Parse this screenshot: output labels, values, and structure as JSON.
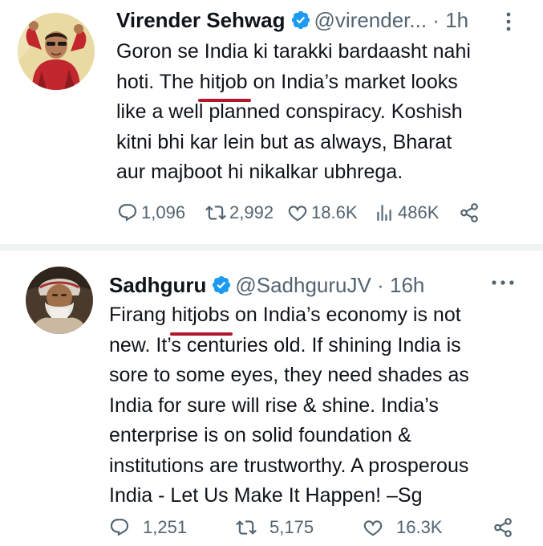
{
  "tweets": [
    {
      "name": "Virender Sehwag",
      "handle": "@virender...",
      "dot": "·",
      "time": "1h",
      "body_lines": [
        [
          "Goron se India ki tarakki bardaasht nahi",
          "",
          ""
        ],
        [
          "hoti. The ",
          "hitjob",
          " on India’s market looks"
        ],
        [
          "like a well planned conspiracy. Koshish",
          "",
          ""
        ],
        [
          "kitni bhi kar lein but as always, Bharat",
          "",
          ""
        ],
        [
          "aur majboot hi nikalkar ubhrega.",
          "",
          ""
        ]
      ],
      "stats": {
        "replies": "1,096",
        "reposts": "2,992",
        "likes": "18.6K",
        "views": "486K"
      }
    },
    {
      "name": "Sadhguru",
      "handle": "@SadhguruJV",
      "dot": "·",
      "time": "16h",
      "body_lines": [
        [
          "Firang ",
          "hitjobs",
          " on India’s economy is not"
        ],
        [
          "new. It’s centuries old. If shining India is",
          "",
          ""
        ],
        [
          "sore to some eyes, they need shades as",
          "",
          ""
        ],
        [
          "India for sure will rise & shine. India’s",
          "",
          ""
        ],
        [
          "enterprise is on solid foundation &",
          "",
          ""
        ],
        [
          "institutions are trustworthy. A prosperous",
          "",
          ""
        ],
        [
          "India - Let Us Make It Happen! –Sg",
          "",
          ""
        ]
      ],
      "stats": {
        "replies": "1,251",
        "reposts": "5,175",
        "likes": "16.3K"
      }
    }
  ],
  "icons": {
    "verified": "verified-badge-icon",
    "more": "more-options-icon",
    "reply": "reply-icon",
    "repost": "repost-icon",
    "like": "heart-icon",
    "views": "views-bar-chart-icon",
    "share": "share-icon"
  },
  "colors": {
    "verified_blue": "#1d9bf0",
    "muted_text": "#536471",
    "annotation_underline": "#b1172a",
    "separator": "#eff3f4"
  }
}
